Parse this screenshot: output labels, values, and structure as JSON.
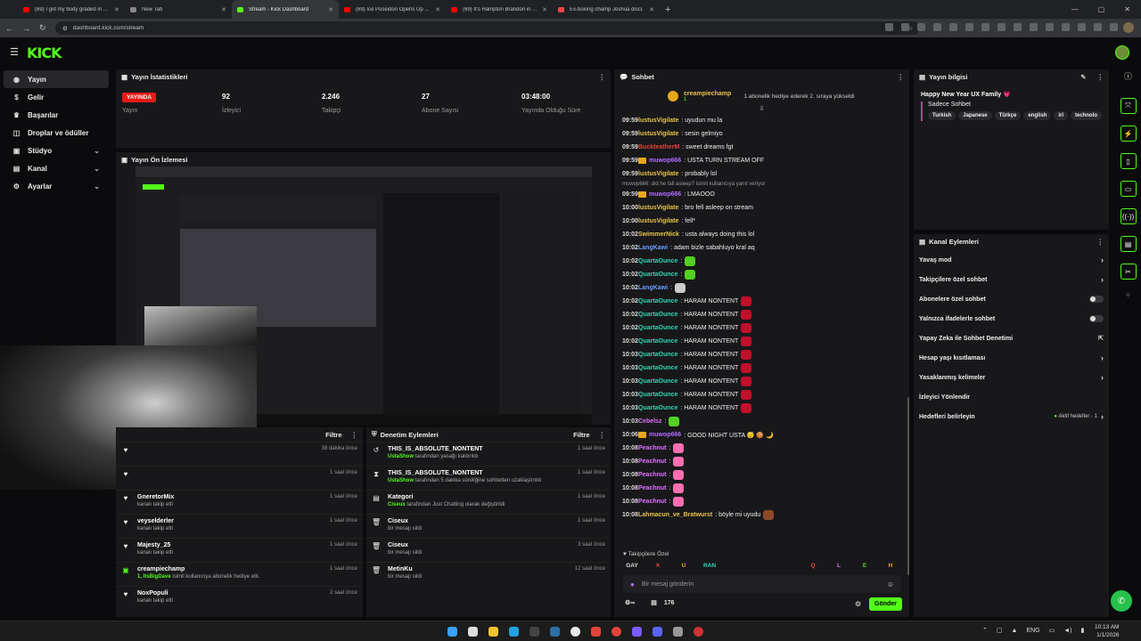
{
  "browser": {
    "tabs": [
      {
        "title": "(69) I got my body graded in ...",
        "color": "#ff0000"
      },
      {
        "title": "New Tab",
        "color": "#888888"
      },
      {
        "title": "Stream - Kick Dashboard",
        "color": "#53fc18"
      },
      {
        "title": "(69) Ice Poseidon Opens Up ...",
        "color": "#ff0000"
      },
      {
        "title": "(69) It's Hampton Brandon in ...",
        "color": "#ff0000"
      },
      {
        "title": "Ex-boxing champ Joshua discl...",
        "color": "#ff4444"
      }
    ],
    "url": "dashboard.kick.com/stream"
  },
  "sidebar": {
    "items": [
      {
        "label": "Yayın",
        "icon": "broadcast-icon"
      },
      {
        "label": "Gelir",
        "icon": "money-icon"
      },
      {
        "label": "Başarılar",
        "icon": "trophy-icon"
      },
      {
        "label": "Droplar ve ödüller",
        "icon": "gift-icon"
      },
      {
        "label": "Stüdyo",
        "icon": "studio-icon"
      },
      {
        "label": "Kanal",
        "icon": "channel-icon"
      },
      {
        "label": "Ayarlar",
        "icon": "gear-icon"
      }
    ]
  },
  "stats": {
    "title": "Yayın İstatistikleri",
    "live_badge": "YAYINDA",
    "live_label": "Yayın",
    "viewers": "92",
    "viewers_label": "İzleyici",
    "followers": "2.246",
    "followers_label": "Takipçi",
    "subs": "27",
    "subs_label": "Abone Sayısı",
    "uptime": "03:48:00",
    "uptime_label": "Yayında Olduğu Süre"
  },
  "preview": {
    "title": "Yayın Ön İzlemesi"
  },
  "activity": {
    "filter": "Filtre",
    "items": [
      {
        "name": "",
        "sub": "",
        "time": "38 dakika önce"
      },
      {
        "name": "",
        "sub": "",
        "time": "1 saat önce"
      },
      {
        "name": "GneretorMix",
        "sub": "kanalı takip etti",
        "time": "1 saat önce"
      },
      {
        "name": "veyselderler",
        "sub": "kanalı takip etti",
        "time": "1 saat önce"
      },
      {
        "name": "Majesty_25",
        "sub": "kanalı takip etti",
        "time": "1 saat önce"
      },
      {
        "name": "creampiechamp",
        "sub": "isimli kullanıcıya abonelik hediye etti.",
        "sub_prefix": "1, ItsBigDave",
        "time": "1 saat önce"
      },
      {
        "name": "NoxPopuli",
        "sub": "kanalı takip etti",
        "time": "2 saat önce"
      }
    ]
  },
  "moderation": {
    "title": "Denetim Eylemleri",
    "filter": "Filtre",
    "items": [
      {
        "name": "THIS_IS_ABSOLUTE_NONTENT",
        "actor": "UstaShow",
        "sub": "tarafından yasağı kaldırıldı",
        "time": "1 saat önce",
        "icon": "undo-icon"
      },
      {
        "name": "THIS_IS_ABSOLUTE_NONTENT",
        "actor": "UstaShow",
        "sub": "tarafından 5 dakika süreliğine sohbetten uzaklaştırıldı",
        "time": "1 saat önce",
        "icon": "hourglass-icon"
      },
      {
        "name": "Kategori",
        "actor": "Ciseux",
        "sub": "tarafından Just Chatting olarak değiştirildi",
        "time": "1 saat önce",
        "icon": "category-icon"
      },
      {
        "name": "Ciseux",
        "actor": "",
        "sub": "bir mesajı sildi",
        "time": "1 saat önce",
        "icon": "trash-icon"
      },
      {
        "name": "Ciseux",
        "actor": "",
        "sub": "bir mesajı sildi",
        "time": "3 saat önce",
        "icon": "trash-icon"
      },
      {
        "name": "MetinKu",
        "actor": "",
        "sub": "bir mesajı sildi",
        "time": "12 saat önce",
        "icon": "trash-icon"
      }
    ]
  },
  "chat": {
    "title": "Sohbet",
    "pinned_user": "creampiechamp",
    "pinned_count": "1",
    "pinned_text": "1 abonelik hediye ederek 2. sıraya yükseldi",
    "reply_note": "muwop666: did he fall asleep? isimli kullanıcıya yanıt veriyor",
    "messages": [
      {
        "t": "09:59",
        "u": "lustusVigilate",
        "c": "#e8c44a",
        "m": ": uyudun mu la"
      },
      {
        "t": "09:59",
        "u": "lustusVigilate",
        "c": "#e8c44a",
        "m": ": sesin gelmiyo"
      },
      {
        "t": "09:59",
        "u": "BuckteatherM",
        "c": "#e0443a",
        "m": ": sweet dreams fgt"
      },
      {
        "t": "09:59",
        "u": "muwop666",
        "c": "#b36bff",
        "m": ": USTA TURN STREAM OFF",
        "badge": true
      },
      {
        "t": "09:59",
        "u": "lustusVigilate",
        "c": "#e8c44a",
        "m": ": probably lol"
      },
      {
        "t": "09:59",
        "u": "muwop666",
        "c": "#b36bff",
        "m": ": LMAOOO",
        "badge": true
      },
      {
        "t": "10:00",
        "u": "lustusVigilate",
        "c": "#e8c44a",
        "m": ": bro fell asleep on stream"
      },
      {
        "t": "10:00",
        "u": "lustusVigilate",
        "c": "#e8c44a",
        "m": ": fell*"
      },
      {
        "t": "10:02",
        "u": "SwimmerNick",
        "c": "#e8c44a",
        "m": ": usta always doing this lol"
      },
      {
        "t": "10:02",
        "u": "LangKawi",
        "c": "#6a9cff",
        "m": ": adam bizle sabahluyo kral aq"
      },
      {
        "t": "10:02",
        "u": "QuartaOunce",
        "c": "#2fd6b5",
        "m": ":",
        "emote": "#53d020"
      },
      {
        "t": "10:02",
        "u": "QuartaOunce",
        "c": "#2fd6b5",
        "m": ":",
        "emote": "#53d020"
      },
      {
        "t": "10:02",
        "u": "LangKawi",
        "c": "#6a9cff",
        "m": ":",
        "emote": "#ccc"
      },
      {
        "t": "10:02",
        "u": "QuartaOunce",
        "c": "#2fd6b5",
        "m": ": HARAM NONTENT",
        "emote": "#c0102a"
      },
      {
        "t": "10:02",
        "u": "QuartaOunce",
        "c": "#2fd6b5",
        "m": ": HARAM NONTENT",
        "emote": "#c0102a"
      },
      {
        "t": "10:02",
        "u": "QuartaOunce",
        "c": "#2fd6b5",
        "m": ": HARAM NONTENT",
        "emote": "#c0102a"
      },
      {
        "t": "10:02",
        "u": "QuartaOunce",
        "c": "#2fd6b5",
        "m": ": HARAM NONTENT",
        "emote": "#c0102a"
      },
      {
        "t": "10:03",
        "u": "QuartaOunce",
        "c": "#2fd6b5",
        "m": ": HARAM NONTENT",
        "emote": "#c0102a"
      },
      {
        "t": "10:03",
        "u": "QuartaOunce",
        "c": "#2fd6b5",
        "m": ": HARAM NONTENT",
        "emote": "#c0102a"
      },
      {
        "t": "10:03",
        "u": "QuartaOunce",
        "c": "#2fd6b5",
        "m": ": HARAM NONTENT",
        "emote": "#c0102a"
      },
      {
        "t": "10:03",
        "u": "QuartaOunce",
        "c": "#2fd6b5",
        "m": ": HARAM NONTENT",
        "emote": "#c0102a"
      },
      {
        "t": "10:03",
        "u": "QuartaOunce",
        "c": "#2fd6b5",
        "m": ": HARAM NONTENT",
        "emote": "#c0102a"
      },
      {
        "t": "10:03",
        "u": "Cebelsz",
        "c": "#e070ff",
        "m": ":",
        "emote": "#53d020"
      },
      {
        "t": "10:06",
        "u": "muwop666",
        "c": "#b36bff",
        "m": ": GOOD NIGHT USTA 😴 🍪 🌙",
        "badge": true
      },
      {
        "t": "10:08",
        "u": "Peachnut",
        "c": "#e070ff",
        "m": ":",
        "emote": "#ff6fb0"
      },
      {
        "t": "10:08",
        "u": "Peachnut",
        "c": "#e070ff",
        "m": ":",
        "emote": "#ff6fb0"
      },
      {
        "t": "10:08",
        "u": "Peachnut",
        "c": "#e070ff",
        "m": ":",
        "emote": "#ff6fb0"
      },
      {
        "t": "10:08",
        "u": "Peachnut",
        "c": "#e070ff",
        "m": ":",
        "emote": "#ff6fb0"
      },
      {
        "t": "10:08",
        "u": "Peachnut",
        "c": "#e070ff",
        "m": ":",
        "emote": "#ff6fb0"
      },
      {
        "t": "10:08",
        "u": "Lahmacun_ve_Bratwurst",
        "c": "#e8c44a",
        "m": ": böyle mi uyudu",
        "emote": "#8a4a2a"
      }
    ],
    "followers_only": "Takipçilere Özel",
    "emote_bar": [
      "GAY",
      "✕",
      "U",
      "RAN",
      "",
      "",
      " ",
      "Q",
      "L",
      "E",
      "H"
    ],
    "input_placeholder": "Bir mesaj gönderin",
    "points": "176",
    "send": "Gönder"
  },
  "stream_info": {
    "title": "Yayın bilgisi",
    "stream_title": "Happy New Year UX Family 💗",
    "category": "Sadece Sohbet",
    "tags": [
      "Turkish",
      "Japanese",
      "Türkçe",
      "english",
      "irl",
      "technolo"
    ]
  },
  "channel_actions": {
    "title": "Kanal Eylemleri",
    "items": [
      {
        "label": "Yavaş mod",
        "kind": "arrow"
      },
      {
        "label": "Takipçilere özel sohbet",
        "kind": "arrow"
      },
      {
        "label": "Abonelere özel sohbet",
        "kind": "toggle"
      },
      {
        "label": "Yalnızca ifadelerle sohbet",
        "kind": "toggle"
      },
      {
        "label": "Yapay Zeka ile Sohbet Denetimi",
        "kind": "external"
      },
      {
        "label": "Hesap yaşı kısıtlaması",
        "kind": "arrow"
      },
      {
        "label": "Yasaklanmış kelimeler",
        "kind": "arrow"
      },
      {
        "label": "İzleyici Yönlendir",
        "kind": "none"
      },
      {
        "label": "Hedefleri belirleyin",
        "kind": "goal",
        "extra": "Aktif hedefler - 1"
      }
    ]
  },
  "taskbar": {
    "lang": "ENG",
    "time": "10:13 AM",
    "date": "1/1/2026"
  }
}
